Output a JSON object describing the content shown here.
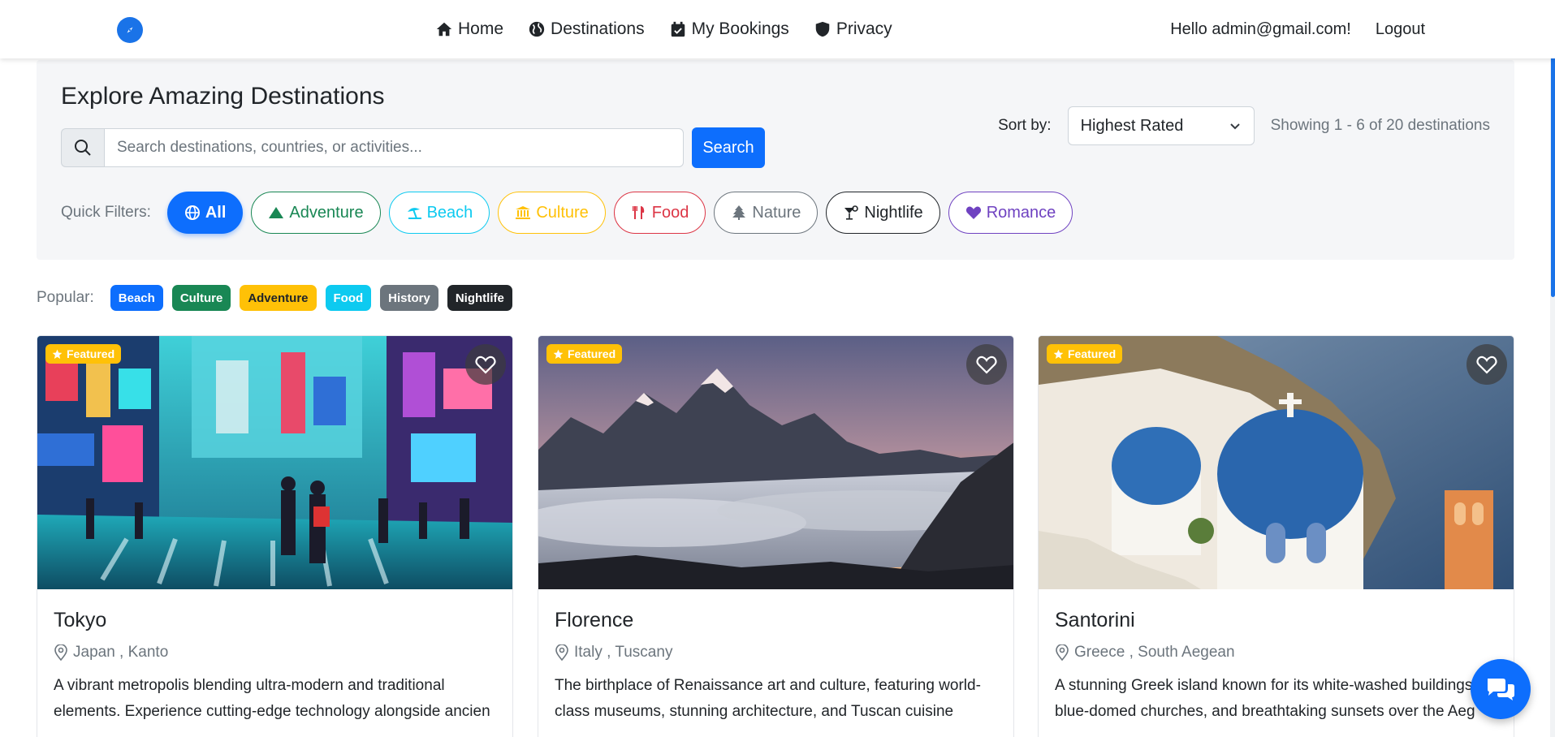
{
  "nav": {
    "brand_icon": "compass-icon",
    "links": [
      {
        "label": "Home",
        "icon": "home-icon"
      },
      {
        "label": "Destinations",
        "icon": "globe-icon"
      },
      {
        "label": "My Bookings",
        "icon": "calendar-check-icon"
      },
      {
        "label": "Privacy",
        "icon": "shield-icon"
      }
    ],
    "greeting": "Hello admin@gmail.com!",
    "logout": "Logout"
  },
  "filters": {
    "title": "Explore Amazing Destinations",
    "search_placeholder": "Search destinations, countries, or activities...",
    "search_button": "Search",
    "sort_label": "Sort by:",
    "sort_value": "Highest Rated",
    "showing": "Showing 1 - 6 of 20 destinations",
    "quick_label": "Quick Filters:",
    "quick": [
      {
        "label": "All",
        "color": "#0d6efd",
        "active": true
      },
      {
        "label": "Adventure",
        "color": "#198754"
      },
      {
        "label": "Beach",
        "color": "#0dcaf0"
      },
      {
        "label": "Culture",
        "color": "#ffc107"
      },
      {
        "label": "Food",
        "color": "#dc3545"
      },
      {
        "label": "Nature",
        "color": "#6c757d"
      },
      {
        "label": "Nightlife",
        "color": "#212529"
      },
      {
        "label": "Romance",
        "color": "#6f42c1"
      }
    ]
  },
  "popular": {
    "label": "Popular:",
    "tags": [
      {
        "label": "Beach",
        "bg": "#0d6efd",
        "fg": "#ffffff"
      },
      {
        "label": "Culture",
        "bg": "#198754",
        "fg": "#ffffff"
      },
      {
        "label": "Adventure",
        "bg": "#ffc107",
        "fg": "#212529"
      },
      {
        "label": "Food",
        "bg": "#0dcaf0",
        "fg": "#ffffff"
      },
      {
        "label": "History",
        "bg": "#6c757d",
        "fg": "#ffffff"
      },
      {
        "label": "Nightlife",
        "bg": "#212529",
        "fg": "#ffffff"
      }
    ]
  },
  "cards": [
    {
      "badge": "Featured",
      "title": "Tokyo",
      "location": "Japan , Kanto",
      "description": "A vibrant metropolis blending ultra-modern and traditional elements. Experience cutting-edge technology alongside ancien"
    },
    {
      "badge": "Featured",
      "title": "Florence",
      "location": "Italy , Tuscany",
      "description": "The birthplace of Renaissance art and culture, featuring world-class museums, stunning architecture, and Tuscan cuisine"
    },
    {
      "badge": "Featured",
      "title": "Santorini",
      "location": "Greece , South Aegean",
      "description": "A stunning Greek island known for its white-washed buildings, blue-domed churches, and breathtaking sunsets over the Aeg"
    }
  ],
  "chat_icon": "chat-bubbles-icon"
}
